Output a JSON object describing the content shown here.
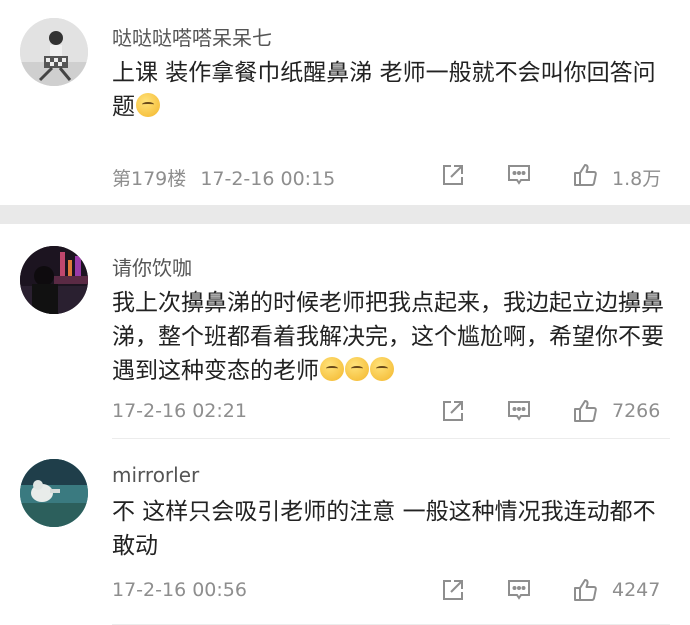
{
  "comments": [
    {
      "username": "哒哒哒嗒嗒呆呆七",
      "text": "上课 装作拿餐巾纸醒鼻涕 老师一般就不会叫你回答问题",
      "emoji_count": 1,
      "floor": "第179楼",
      "time": "17-2-16 00:15",
      "likes": "1.8万",
      "avatar_icon": "avatar-icon"
    },
    {
      "username": "请你饮咖",
      "text": "我上次擤鼻涕的时候老师把我点起来，我边起立边擤鼻涕，整个班都看着我解决完，这个尴尬啊，希望你不要遇到这种变态的老师",
      "emoji_count": 3,
      "floor": "",
      "time": "17-2-16 02:21",
      "likes": "7266",
      "avatar_icon": "avatar-icon"
    },
    {
      "username": "mirrorler",
      "text": "不 这样只会吸引老师的注意 一般这种情况我连动都不敢动",
      "emoji_count": 0,
      "floor": "",
      "time": "17-2-16 00:56",
      "likes": "4247",
      "avatar_icon": "avatar-icon"
    }
  ],
  "icons": {
    "share": "share-icon",
    "comment": "comment-icon",
    "like": "thumbs-up-icon"
  },
  "colors": {
    "text": "#222222",
    "meta": "#8e8e8e",
    "separator": "#e9e9e9"
  }
}
